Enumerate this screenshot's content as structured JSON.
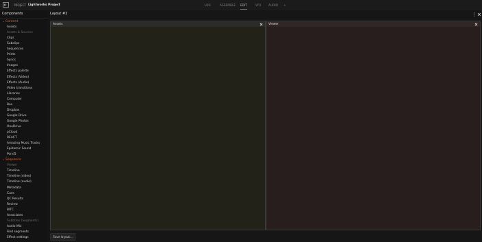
{
  "topbar": {
    "project_label": "PROJECT",
    "project_name": "Lightworks Project",
    "tabs": [
      {
        "label": "LOG",
        "active": false
      },
      {
        "label": "ASSEMBLE",
        "active": false
      },
      {
        "label": "EDIT",
        "active": true
      },
      {
        "label": "VFX",
        "active": false
      },
      {
        "label": "AUDIO",
        "active": false
      },
      {
        "label": "+",
        "active": false
      }
    ]
  },
  "sidebar": {
    "title": "Components",
    "content_group": "Content",
    "content_items": [
      {
        "label": "Assets",
        "enabled": true
      },
      {
        "label": "Assets & Sources",
        "enabled": false
      },
      {
        "label": "Clips",
        "enabled": true
      },
      {
        "label": "Subclips",
        "enabled": true
      },
      {
        "label": "Sequences",
        "enabled": true
      },
      {
        "label": "Prints",
        "enabled": true
      },
      {
        "label": "Syncs",
        "enabled": true
      },
      {
        "label": "Images",
        "enabled": true
      },
      {
        "label": "Effects palette",
        "enabled": true
      },
      {
        "label": "Effects (Video)",
        "enabled": true
      },
      {
        "label": "Effects (Audio)",
        "enabled": true
      },
      {
        "label": "Video transitions",
        "enabled": true
      },
      {
        "label": "Libraries",
        "enabled": true
      },
      {
        "label": "Computer",
        "enabled": true
      },
      {
        "label": "Box",
        "enabled": true
      },
      {
        "label": "Dropbox",
        "enabled": true
      },
      {
        "label": "Google Drive",
        "enabled": true
      },
      {
        "label": "Google Photos",
        "enabled": true
      },
      {
        "label": "OneDrive",
        "enabled": true
      },
      {
        "label": "pCloud",
        "enabled": true
      },
      {
        "label": "REACT",
        "enabled": true
      },
      {
        "label": "Amazing Music Tracks",
        "enabled": true
      },
      {
        "label": "Epidemic Sound",
        "enabled": true
      },
      {
        "label": "Pond5",
        "enabled": true
      }
    ],
    "sequence_group": "Sequence",
    "sequence_items": [
      {
        "label": "Viewer",
        "enabled": false
      },
      {
        "label": "Timeline",
        "enabled": true
      },
      {
        "label": "Timeline (video)",
        "enabled": true
      },
      {
        "label": "Timeline (audio)",
        "enabled": true
      },
      {
        "label": "Metadata",
        "enabled": true
      },
      {
        "label": "Cues",
        "enabled": true
      },
      {
        "label": "QC Results",
        "enabled": true
      },
      {
        "label": "Review",
        "enabled": true
      },
      {
        "label": "BITC",
        "enabled": true
      },
      {
        "label": "Associates",
        "enabled": true
      },
      {
        "label": "Subtitles (Segments)",
        "enabled": false
      },
      {
        "label": "Audio Mix",
        "enabled": true
      },
      {
        "label": "Find segments",
        "enabled": true
      },
      {
        "label": "Effect settings",
        "enabled": true
      }
    ]
  },
  "layout": {
    "title": "Layout #1",
    "panels": [
      {
        "title": "Assets"
      },
      {
        "title": "Viewer"
      }
    ],
    "save_label": "Save layout..."
  },
  "colors": {
    "accent": "#e0633a",
    "background": "#161616",
    "assets_panel": "#222219",
    "viewer_panel": "#271e1d"
  }
}
